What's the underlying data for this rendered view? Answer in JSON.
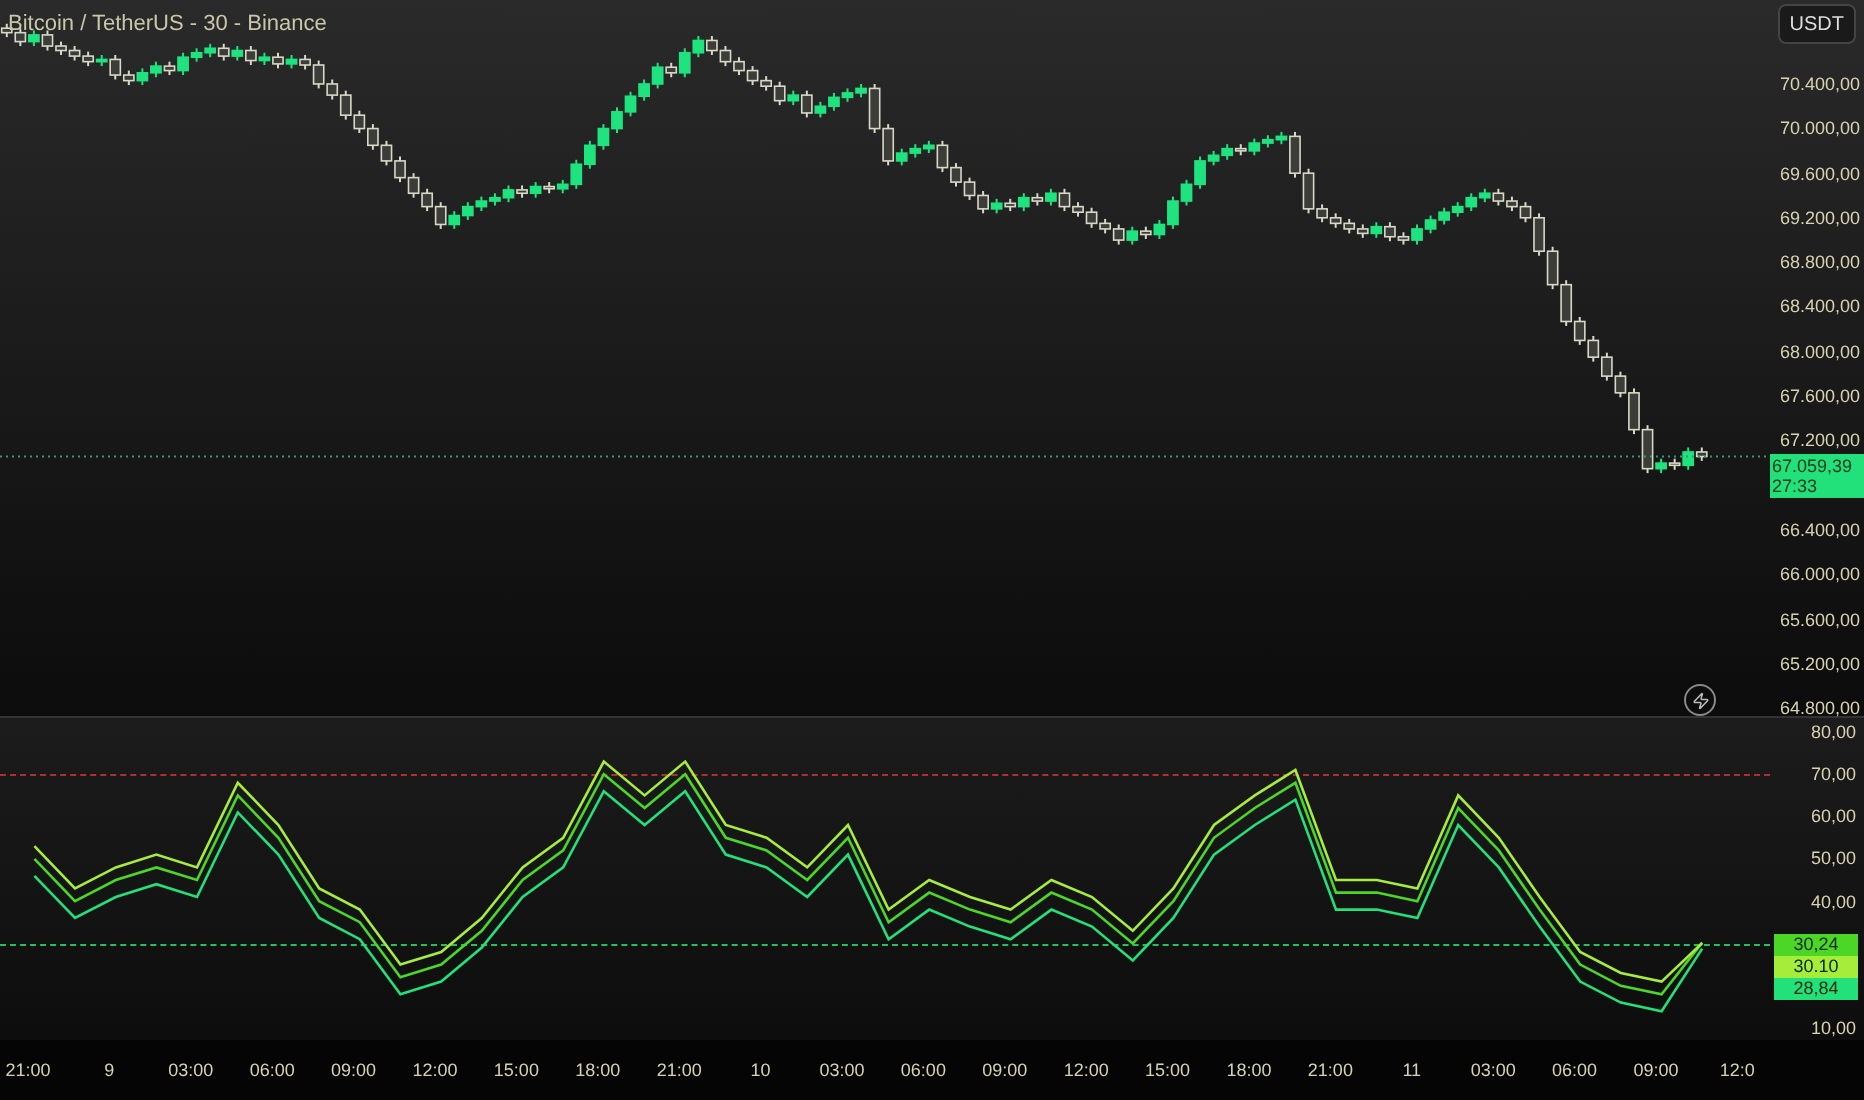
{
  "title": "Bitcoin / TetherUS - 30 - Binance",
  "currency_button": "USDT",
  "price_chart": {
    "chart_data": {
      "type": "candlestick",
      "categories": [
        null,
        null,
        null,
        null,
        null,
        null,
        null,
        null,
        null,
        null,
        null,
        null,
        null,
        null,
        null,
        null,
        null,
        null,
        null,
        null,
        null,
        null,
        null,
        null,
        null,
        null,
        null,
        null,
        null,
        null,
        null,
        null,
        null,
        null,
        null,
        null,
        null,
        null,
        null,
        null,
        null,
        null,
        null,
        null,
        null,
        null,
        null,
        null,
        null,
        null,
        null,
        null,
        null,
        null,
        null,
        null,
        null,
        null,
        null,
        null,
        null,
        null,
        null,
        null,
        null,
        null,
        null,
        null,
        null,
        null,
        null,
        null,
        null,
        null,
        null,
        null,
        null,
        null,
        null,
        null,
        null,
        null,
        null,
        null,
        null,
        null,
        null,
        null,
        null,
        null,
        null,
        null,
        null,
        null,
        null,
        null,
        null,
        null,
        null,
        null,
        null,
        null,
        null,
        null,
        null,
        null,
        null,
        null,
        null,
        null,
        null,
        null,
        null,
        null,
        null,
        null,
        null,
        null,
        null,
        null,
        null,
        null,
        null,
        null,
        null,
        null
      ],
      "ohlc": [
        [
          70900,
          70940,
          70820,
          70860
        ],
        [
          70860,
          70900,
          70740,
          70780
        ],
        [
          70780,
          70880,
          70740,
          70840
        ],
        [
          70840,
          70880,
          70700,
          70740
        ],
        [
          70740,
          70780,
          70660,
          70700
        ],
        [
          70700,
          70740,
          70610,
          70650
        ],
        [
          70650,
          70690,
          70560,
          70600
        ],
        [
          70600,
          70660,
          70560,
          70620
        ],
        [
          70620,
          70660,
          70440,
          70480
        ],
        [
          70480,
          70520,
          70390,
          70430
        ],
        [
          70430,
          70540,
          70390,
          70500
        ],
        [
          70500,
          70600,
          70460,
          70560
        ],
        [
          70560,
          70600,
          70480,
          70520
        ],
        [
          70520,
          70680,
          70480,
          70640
        ],
        [
          70640,
          70720,
          70600,
          70680
        ],
        [
          70680,
          70760,
          70640,
          70720
        ],
        [
          70720,
          70760,
          70610,
          70650
        ],
        [
          70650,
          70740,
          70610,
          70700
        ],
        [
          70700,
          70740,
          70570,
          70610
        ],
        [
          70610,
          70680,
          70570,
          70640
        ],
        [
          70640,
          70680,
          70540,
          70580
        ],
        [
          70580,
          70660,
          70540,
          70620
        ],
        [
          70620,
          70660,
          70530,
          70570
        ],
        [
          70570,
          70610,
          70360,
          70400
        ],
        [
          70400,
          70440,
          70260,
          70300
        ],
        [
          70300,
          70340,
          70080,
          70120
        ],
        [
          70120,
          70160,
          69960,
          70000
        ],
        [
          70000,
          70040,
          69810,
          69850
        ],
        [
          69850,
          69890,
          69670,
          69710
        ],
        [
          69710,
          69750,
          69520,
          69560
        ],
        [
          69560,
          69600,
          69380,
          69420
        ],
        [
          69420,
          69460,
          69260,
          69300
        ],
        [
          69300,
          69340,
          69100,
          69140
        ],
        [
          69140,
          69260,
          69100,
          69220
        ],
        [
          69220,
          69340,
          69180,
          69300
        ],
        [
          69300,
          69390,
          69260,
          69350
        ],
        [
          69350,
          69420,
          69310,
          69380
        ],
        [
          69380,
          69490,
          69340,
          69450
        ],
        [
          69450,
          69490,
          69380,
          69420
        ],
        [
          69420,
          69520,
          69380,
          69480
        ],
        [
          69480,
          69520,
          69420,
          69460
        ],
        [
          69460,
          69540,
          69420,
          69500
        ],
        [
          69500,
          69720,
          69460,
          69680
        ],
        [
          69680,
          69890,
          69640,
          69850
        ],
        [
          69850,
          70040,
          69810,
          70000
        ],
        [
          70000,
          70190,
          69960,
          70150
        ],
        [
          70150,
          70330,
          70110,
          70290
        ],
        [
          70290,
          70440,
          70250,
          70400
        ],
        [
          70400,
          70590,
          70360,
          70550
        ],
        [
          70550,
          70590,
          70460,
          70500
        ],
        [
          70500,
          70720,
          70460,
          70680
        ],
        [
          70680,
          70830,
          70640,
          70790
        ],
        [
          70790,
          70830,
          70660,
          70700
        ],
        [
          70700,
          70740,
          70560,
          70600
        ],
        [
          70600,
          70640,
          70480,
          70520
        ],
        [
          70520,
          70560,
          70390,
          70430
        ],
        [
          70430,
          70470,
          70340,
          70380
        ],
        [
          70380,
          70420,
          70210,
          70250
        ],
        [
          70250,
          70340,
          70210,
          70300
        ],
        [
          70300,
          70340,
          70100,
          70140
        ],
        [
          70140,
          70240,
          70100,
          70200
        ],
        [
          70200,
          70320,
          70160,
          70280
        ],
        [
          70280,
          70360,
          70240,
          70320
        ],
        [
          70320,
          70400,
          70280,
          70360
        ],
        [
          70360,
          70400,
          69960,
          70000
        ],
        [
          70000,
          70040,
          69670,
          69710
        ],
        [
          69710,
          69820,
          69670,
          69780
        ],
        [
          69780,
          69860,
          69740,
          69820
        ],
        [
          69820,
          69890,
          69780,
          69850
        ],
        [
          69850,
          69890,
          69610,
          69650
        ],
        [
          69650,
          69690,
          69480,
          69520
        ],
        [
          69520,
          69560,
          69360,
          69400
        ],
        [
          69400,
          69440,
          69240,
          69280
        ],
        [
          69280,
          69370,
          69240,
          69330
        ],
        [
          69330,
          69370,
          69260,
          69300
        ],
        [
          69300,
          69420,
          69260,
          69380
        ],
        [
          69380,
          69420,
          69310,
          69350
        ],
        [
          69350,
          69460,
          69310,
          69420
        ],
        [
          69420,
          69460,
          69260,
          69300
        ],
        [
          69300,
          69340,
          69210,
          69250
        ],
        [
          69250,
          69290,
          69110,
          69150
        ],
        [
          69150,
          69190,
          69060,
          69100
        ],
        [
          69100,
          69140,
          68960,
          69000
        ],
        [
          69000,
          69120,
          68960,
          69080
        ],
        [
          69080,
          69120,
          69010,
          69050
        ],
        [
          69050,
          69180,
          69010,
          69140
        ],
        [
          69140,
          69390,
          69100,
          69350
        ],
        [
          69350,
          69540,
          69310,
          69500
        ],
        [
          69500,
          69750,
          69460,
          69710
        ],
        [
          69710,
          69800,
          69670,
          69760
        ],
        [
          69760,
          69860,
          69720,
          69820
        ],
        [
          69820,
          69860,
          69760,
          69800
        ],
        [
          69800,
          69910,
          69760,
          69870
        ],
        [
          69870,
          69940,
          69830,
          69900
        ],
        [
          69900,
          69970,
          69860,
          69930
        ],
        [
          69930,
          69970,
          69560,
          69600
        ],
        [
          69600,
          69640,
          69240,
          69280
        ],
        [
          69280,
          69320,
          69160,
          69200
        ],
        [
          69200,
          69240,
          69110,
          69150
        ],
        [
          69150,
          69190,
          69060,
          69100
        ],
        [
          69100,
          69140,
          69020,
          69060
        ],
        [
          69060,
          69160,
          69020,
          69120
        ],
        [
          69120,
          69160,
          68990,
          69030
        ],
        [
          69030,
          69070,
          68960,
          69000
        ],
        [
          69000,
          69140,
          68960,
          69100
        ],
        [
          69100,
          69220,
          69060,
          69180
        ],
        [
          69180,
          69290,
          69140,
          69250
        ],
        [
          69250,
          69340,
          69210,
          69300
        ],
        [
          69300,
          69420,
          69260,
          69380
        ],
        [
          69380,
          69460,
          69340,
          69420
        ],
        [
          69420,
          69460,
          69310,
          69350
        ],
        [
          69350,
          69390,
          69260,
          69300
        ],
        [
          69300,
          69340,
          69160,
          69200
        ],
        [
          69200,
          69240,
          68860,
          68900
        ],
        [
          68900,
          68940,
          68560,
          68600
        ],
        [
          68600,
          68640,
          68230,
          68270
        ],
        [
          68270,
          68310,
          68060,
          68100
        ],
        [
          68100,
          68140,
          67910,
          67950
        ],
        [
          67950,
          67990,
          67740,
          67780
        ],
        [
          67780,
          67820,
          67590,
          67630
        ],
        [
          67630,
          67670,
          67260,
          67300
        ],
        [
          67300,
          67340,
          66910,
          66950
        ],
        [
          66950,
          67040,
          66910,
          67000
        ],
        [
          67000,
          67040,
          66940,
          66980
        ],
        [
          66980,
          67140,
          66940,
          67100
        ],
        [
          67100,
          67140,
          67020,
          67059
        ]
      ],
      "ylim": [
        64732,
        71153
      ],
      "ref_lines": [
        {
          "axis": "y",
          "value": 67059.39,
          "color": "#3a9a6a"
        }
      ],
      "yticks": [
        {
          "value": 70400,
          "label": "70.400,00"
        },
        {
          "value": 70000,
          "label": "70.000,00"
        },
        {
          "value": 69600,
          "label": "69.600,00"
        },
        {
          "value": 69200,
          "label": "69.200,00"
        },
        {
          "value": 68800,
          "label": "68.800,00"
        },
        {
          "value": 68400,
          "label": "68.400,00"
        },
        {
          "value": 68000,
          "label": "68.000,00"
        },
        {
          "value": 67600,
          "label": "67.600,00"
        },
        {
          "value": 67200,
          "label": "67.200,00"
        },
        {
          "value": 66400,
          "label": "66.400,00"
        },
        {
          "value": 66000,
          "label": "66.000,00"
        },
        {
          "value": 65600,
          "label": "65.600,00"
        },
        {
          "value": 65200,
          "label": "65.200,00"
        },
        {
          "value": 64800,
          "label": "64.800,00"
        }
      ]
    },
    "last_price": {
      "price": "67.059,39",
      "countdown": "27:33"
    }
  },
  "oscillator": {
    "chart_data": {
      "type": "line",
      "categories": [
        null,
        null,
        null,
        null,
        null,
        null,
        null,
        null,
        null,
        null,
        null,
        null,
        null,
        null,
        null,
        null,
        null,
        null,
        null,
        null,
        null,
        null,
        null,
        null,
        null,
        null,
        null,
        null,
        null,
        null,
        null,
        null,
        null,
        null,
        null,
        null,
        null,
        null,
        null,
        null,
        null,
        null
      ],
      "series": [
        {
          "color": "#4cd625",
          "values": [
            50,
            40,
            45,
            48,
            45,
            65,
            55,
            40,
            35,
            22,
            25,
            33,
            45,
            52,
            70,
            62,
            70,
            55,
            52,
            45,
            55,
            35,
            42,
            38,
            35,
            42,
            38,
            30,
            40,
            55,
            62,
            68,
            42,
            42,
            40,
            62,
            52,
            38,
            25,
            20,
            18,
            30.2
          ]
        },
        {
          "color": "#a6ec3a",
          "values": [
            53,
            43,
            48,
            51,
            48,
            68,
            58,
            43,
            38,
            25,
            28,
            36,
            48,
            55,
            73,
            65,
            73,
            58,
            55,
            48,
            58,
            38,
            45,
            41,
            38,
            45,
            41,
            33,
            43,
            58,
            65,
            71,
            45,
            45,
            43,
            65,
            55,
            41,
            28,
            23,
            21,
            30.1
          ]
        },
        {
          "color": "#22e07a",
          "values": [
            46,
            36,
            41,
            44,
            41,
            61,
            51,
            36,
            31,
            18,
            21,
            29,
            41,
            48,
            66,
            58,
            66,
            51,
            48,
            41,
            51,
            31,
            38,
            34,
            31,
            38,
            34,
            26,
            36,
            51,
            58,
            64,
            38,
            38,
            36,
            58,
            48,
            34,
            21,
            16,
            14,
            28.8
          ]
        }
      ],
      "ylim": [
        6.7,
        83.3
      ],
      "yticks": [
        {
          "value": 80,
          "label": "80,00"
        },
        {
          "value": 70,
          "label": "70,00"
        },
        {
          "value": 60,
          "label": "60,00"
        },
        {
          "value": 50,
          "label": "50,00"
        },
        {
          "value": 40,
          "label": "40,00"
        },
        {
          "value": 10,
          "label": "10,00"
        }
      ],
      "ref_lines": [
        {
          "axis": "y",
          "value": 70,
          "color": "#b03030"
        },
        {
          "axis": "y",
          "value": 30,
          "color": "#22c060"
        }
      ]
    },
    "value_tags": [
      {
        "text": "30,24",
        "color": "#4cd625"
      },
      {
        "text": "30.10",
        "color": "#a6ec3a"
      },
      {
        "text": "28,84",
        "color": "#22e07a"
      }
    ]
  },
  "time_axis": [
    "21:00",
    "9",
    "03:00",
    "06:00",
    "09:00",
    "12:00",
    "15:00",
    "18:00",
    "21:00",
    "10",
    "03:00",
    "06:00",
    "09:00",
    "12:00",
    "15:00",
    "18:00",
    "21:00",
    "11",
    "03:00",
    "06:00",
    "09:00",
    "12:0"
  ]
}
